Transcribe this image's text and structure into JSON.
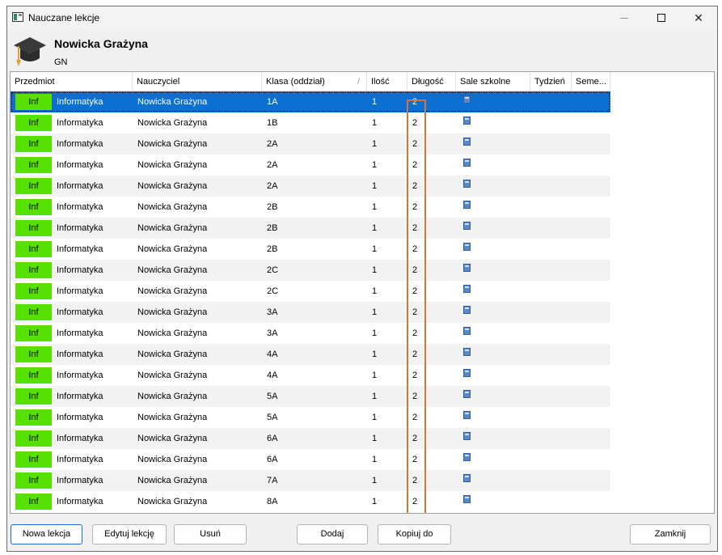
{
  "window": {
    "title": "Nauczane lekcje",
    "min_icon": "minimize-icon",
    "max_icon": "maximize-icon",
    "close_icon": "close-icon",
    "close_glyph": "✕"
  },
  "header": {
    "name": "Nowicka Grażyna",
    "short": "GN",
    "icon": "graduation-cap-icon"
  },
  "table": {
    "columns": [
      "Przedmiot",
      "Nauczyciel",
      "Klasa (oddział)",
      "Ilość",
      "Długość",
      "Sale szkolne",
      "Tydzień",
      "Seme..."
    ],
    "sort_indicator": "/",
    "badge_color": "#58e000",
    "selected_color": "#0b70d2",
    "rows": [
      {
        "badge": "Inf",
        "subject": "Informatyka",
        "teacher": "Nowicka Grażyna",
        "class": "1A",
        "count": "1",
        "length": "2"
      },
      {
        "badge": "Inf",
        "subject": "Informatyka",
        "teacher": "Nowicka Grażyna",
        "class": "1B",
        "count": "1",
        "length": "2"
      },
      {
        "badge": "Inf",
        "subject": "Informatyka",
        "teacher": "Nowicka Grażyna",
        "class": "2A",
        "count": "1",
        "length": "2"
      },
      {
        "badge": "Inf",
        "subject": "Informatyka",
        "teacher": "Nowicka Grażyna",
        "class": "2A",
        "count": "1",
        "length": "2"
      },
      {
        "badge": "Inf",
        "subject": "Informatyka",
        "teacher": "Nowicka Grażyna",
        "class": "2A",
        "count": "1",
        "length": "2"
      },
      {
        "badge": "Inf",
        "subject": "Informatyka",
        "teacher": "Nowicka Grażyna",
        "class": "2B",
        "count": "1",
        "length": "2"
      },
      {
        "badge": "Inf",
        "subject": "Informatyka",
        "teacher": "Nowicka Grażyna",
        "class": "2B",
        "count": "1",
        "length": "2"
      },
      {
        "badge": "Inf",
        "subject": "Informatyka",
        "teacher": "Nowicka Grażyna",
        "class": "2B",
        "count": "1",
        "length": "2"
      },
      {
        "badge": "Inf",
        "subject": "Informatyka",
        "teacher": "Nowicka Grażyna",
        "class": "2C",
        "count": "1",
        "length": "2"
      },
      {
        "badge": "Inf",
        "subject": "Informatyka",
        "teacher": "Nowicka Grażyna",
        "class": "2C",
        "count": "1",
        "length": "2"
      },
      {
        "badge": "Inf",
        "subject": "Informatyka",
        "teacher": "Nowicka Grażyna",
        "class": "3A",
        "count": "1",
        "length": "2"
      },
      {
        "badge": "Inf",
        "subject": "Informatyka",
        "teacher": "Nowicka Grażyna",
        "class": "3A",
        "count": "1",
        "length": "2"
      },
      {
        "badge": "Inf",
        "subject": "Informatyka",
        "teacher": "Nowicka Grażyna",
        "class": "4A",
        "count": "1",
        "length": "2"
      },
      {
        "badge": "Inf",
        "subject": "Informatyka",
        "teacher": "Nowicka Grażyna",
        "class": "4A",
        "count": "1",
        "length": "2"
      },
      {
        "badge": "Inf",
        "subject": "Informatyka",
        "teacher": "Nowicka Grażyna",
        "class": "5A",
        "count": "1",
        "length": "2"
      },
      {
        "badge": "Inf",
        "subject": "Informatyka",
        "teacher": "Nowicka Grażyna",
        "class": "5A",
        "count": "1",
        "length": "2"
      },
      {
        "badge": "Inf",
        "subject": "Informatyka",
        "teacher": "Nowicka Grażyna",
        "class": "6A",
        "count": "1",
        "length": "2"
      },
      {
        "badge": "Inf",
        "subject": "Informatyka",
        "teacher": "Nowicka Grażyna",
        "class": "6A",
        "count": "1",
        "length": "2"
      },
      {
        "badge": "Inf",
        "subject": "Informatyka",
        "teacher": "Nowicka Grażyna",
        "class": "7A",
        "count": "1",
        "length": "2"
      },
      {
        "badge": "Inf",
        "subject": "Informatyka",
        "teacher": "Nowicka Grażyna",
        "class": "8A",
        "count": "1",
        "length": "2"
      }
    ],
    "room_icon": "classroom-icon"
  },
  "buttons": {
    "new": "Nowa lekcja",
    "edit": "Edytuj lekcję",
    "delete": "Usuń",
    "add": "Dodaj",
    "copy": "Kopiuj do",
    "close": "Zamknij"
  }
}
